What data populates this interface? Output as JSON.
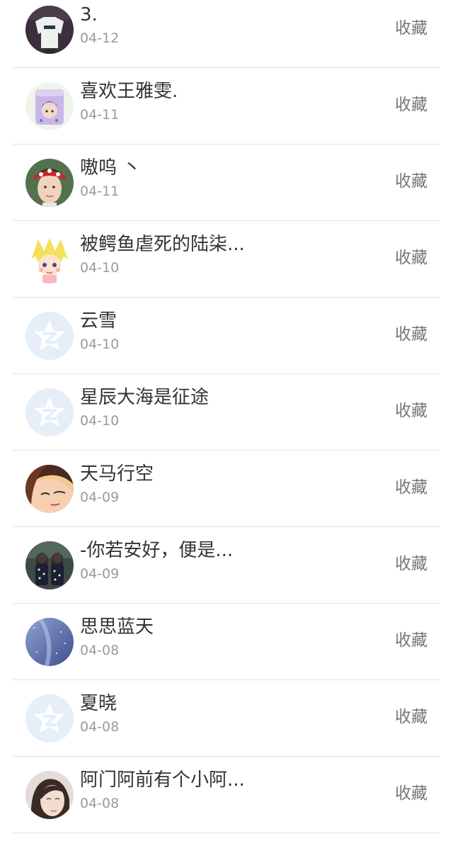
{
  "contacts": [
    {
      "name": "3.",
      "date": "04-12",
      "action": "收藏",
      "avatar": "photo-tshirt"
    },
    {
      "name": "喜欢王雅雯.",
      "date": "04-11",
      "action": "收藏",
      "avatar": "cartoon-cup"
    },
    {
      "name": "嗷呜 丶",
      "date": "04-11",
      "action": "收藏",
      "avatar": "photo-headband"
    },
    {
      "name": "被鳄鱼虐死的陆柒...",
      "date": "04-10",
      "action": "收藏",
      "avatar": "anime-blonde"
    },
    {
      "name": "云雪",
      "date": "04-10",
      "action": "收藏",
      "avatar": "default-qzone"
    },
    {
      "name": "星辰大海是征途",
      "date": "04-10",
      "action": "收藏",
      "avatar": "default-qzone"
    },
    {
      "name": "天马行空",
      "date": "04-09",
      "action": "收藏",
      "avatar": "anime-face"
    },
    {
      "name": "-你若安好，便是...",
      "date": "04-09",
      "action": "收藏",
      "avatar": "photo-two-girls"
    },
    {
      "name": "思思蓝天",
      "date": "04-08",
      "action": "收藏",
      "avatar": "photo-blue-sky"
    },
    {
      "name": "夏晓",
      "date": "04-08",
      "action": "收藏",
      "avatar": "default-qzone"
    },
    {
      "name": "阿门阿前有个小阿...",
      "date": "04-08",
      "action": "收藏",
      "avatar": "photo-portrait"
    }
  ],
  "colors": {
    "name_text": "#333333",
    "date_text": "#9a9a9a",
    "action_text": "#777777",
    "divider": "#e3e3e3",
    "default_avatar_bg": "#e6eef8"
  }
}
